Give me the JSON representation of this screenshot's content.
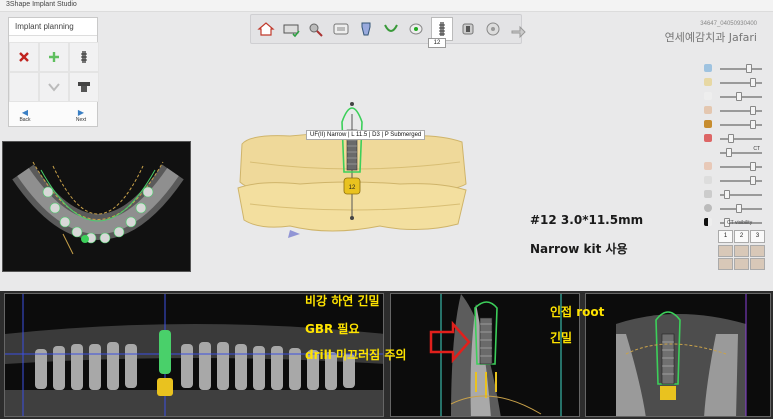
{
  "window": {
    "app_name": "3Shape Implant Studio"
  },
  "patient": {
    "id": "34647_04050930400",
    "name": "연세예감치과 Jafari"
  },
  "workflow": {
    "steps": [
      "home-icon",
      "model-icon",
      "tools-icon",
      "scan-icon",
      "segment-icon",
      "crown-icon",
      "tooth-icon",
      "implant-icon",
      "sleeve-icon",
      "guide-icon",
      "export-icon"
    ],
    "active_tag": "12"
  },
  "planning_panel": {
    "title": "Implant planning",
    "back_label": "Back",
    "next_label": "Next"
  },
  "view3d": {
    "implant_label": "UF(II) Narrow | L 11.5 | D3 | P Submerged",
    "tooth_number": "12"
  },
  "annotations": {
    "spec": "#12 3.0*11.5mm",
    "kit": "Narrow kit 사용",
    "line1": "비강 하연 긴밀",
    "line2": "GBR 필요",
    "line3": "drill 미끄러짐 주의",
    "adjacent_root": "인접 root",
    "close": "긴밀"
  },
  "right_panel": {
    "ct_label": "CT",
    "ct_visibility": "CT visibility",
    "tabs": [
      "1",
      "2",
      "3"
    ]
  },
  "colors": {
    "model": "#efd99a",
    "implant_gold": "#e9c21f",
    "implant_green": "#5fd36e",
    "crown_green": "#3ccf5a",
    "annotation_yellow": "#ffe400"
  }
}
